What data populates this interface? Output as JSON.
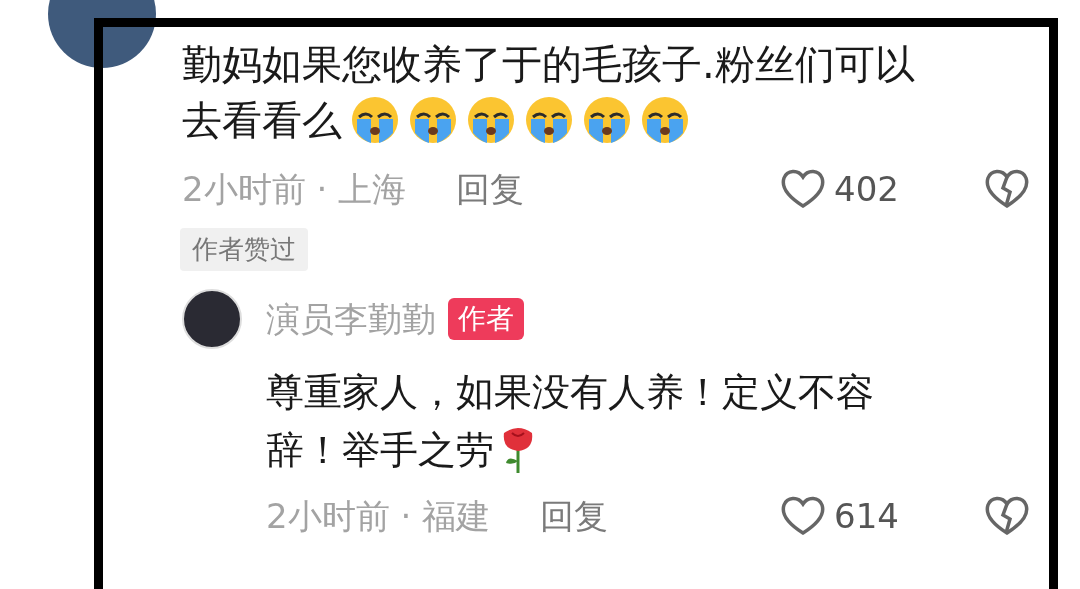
{
  "comment": {
    "text_lines": [
      "勤妈如果您收养了于的毛孩子.粉丝们可以",
      "去看看么"
    ],
    "time_location": "2小时前 · 上海",
    "reply_button": "回复",
    "likes": "402",
    "author_liked_badge": "作者赞过"
  },
  "reply": {
    "name": "演员李勤勤",
    "badge": "作者",
    "text_lines": [
      "尊重家人，如果没有人养！定义不容",
      "辞！举手之劳"
    ],
    "time_location": "2小时前 · 福建",
    "reply_button": "回复",
    "likes": "614"
  }
}
